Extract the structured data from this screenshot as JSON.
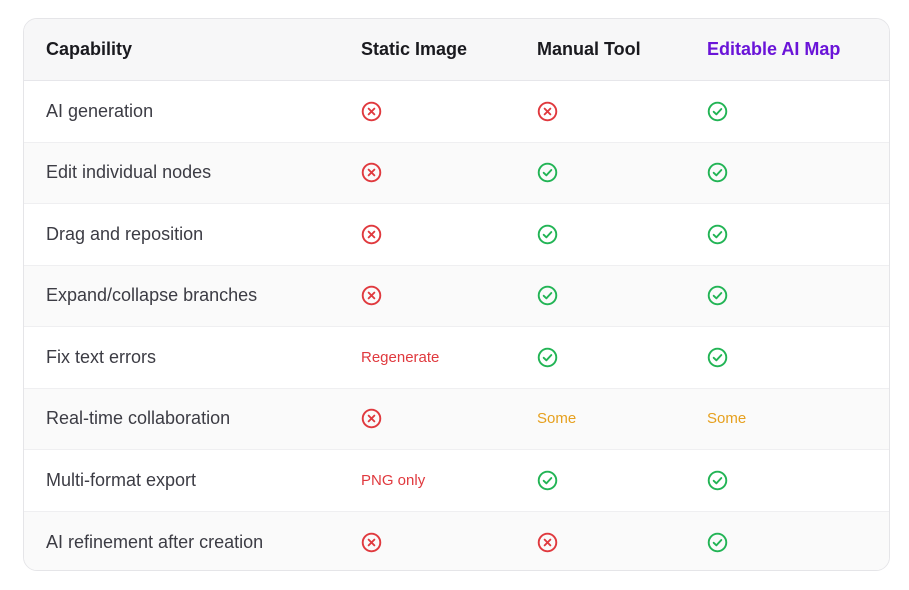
{
  "table": {
    "headers": [
      "Capability",
      "Static Image",
      "Manual Tool",
      "Editable AI Map"
    ],
    "accent_header_color": "#6a14d8",
    "rows": [
      {
        "capability": "AI generation",
        "static": {
          "kind": "cross"
        },
        "manual": {
          "kind": "cross"
        },
        "editable": {
          "kind": "check"
        }
      },
      {
        "capability": "Edit individual nodes",
        "static": {
          "kind": "cross"
        },
        "manual": {
          "kind": "check"
        },
        "editable": {
          "kind": "check"
        }
      },
      {
        "capability": "Drag and reposition",
        "static": {
          "kind": "cross"
        },
        "manual": {
          "kind": "check"
        },
        "editable": {
          "kind": "check"
        }
      },
      {
        "capability": "Expand/collapse branches",
        "static": {
          "kind": "cross"
        },
        "manual": {
          "kind": "check"
        },
        "editable": {
          "kind": "check"
        }
      },
      {
        "capability": "Fix text errors",
        "static": {
          "kind": "text",
          "text": "Regenerate",
          "tone": "red"
        },
        "manual": {
          "kind": "check"
        },
        "editable": {
          "kind": "check"
        }
      },
      {
        "capability": "Real-time collaboration",
        "static": {
          "kind": "cross"
        },
        "manual": {
          "kind": "text",
          "text": "Some",
          "tone": "amber"
        },
        "editable": {
          "kind": "text",
          "text": "Some",
          "tone": "amber"
        }
      },
      {
        "capability": "Multi-format export",
        "static": {
          "kind": "text",
          "text": "PNG only",
          "tone": "red"
        },
        "manual": {
          "kind": "check"
        },
        "editable": {
          "kind": "check"
        }
      },
      {
        "capability": "AI refinement after creation",
        "static": {
          "kind": "cross"
        },
        "manual": {
          "kind": "cross"
        },
        "editable": {
          "kind": "check"
        }
      }
    ]
  },
  "colors": {
    "check": "#22b455",
    "cross": "#e0393e",
    "red_text": "#e0393e",
    "amber_text": "#e6a01e"
  },
  "icons": {
    "check": "check-circle-icon",
    "cross": "x-circle-icon"
  }
}
